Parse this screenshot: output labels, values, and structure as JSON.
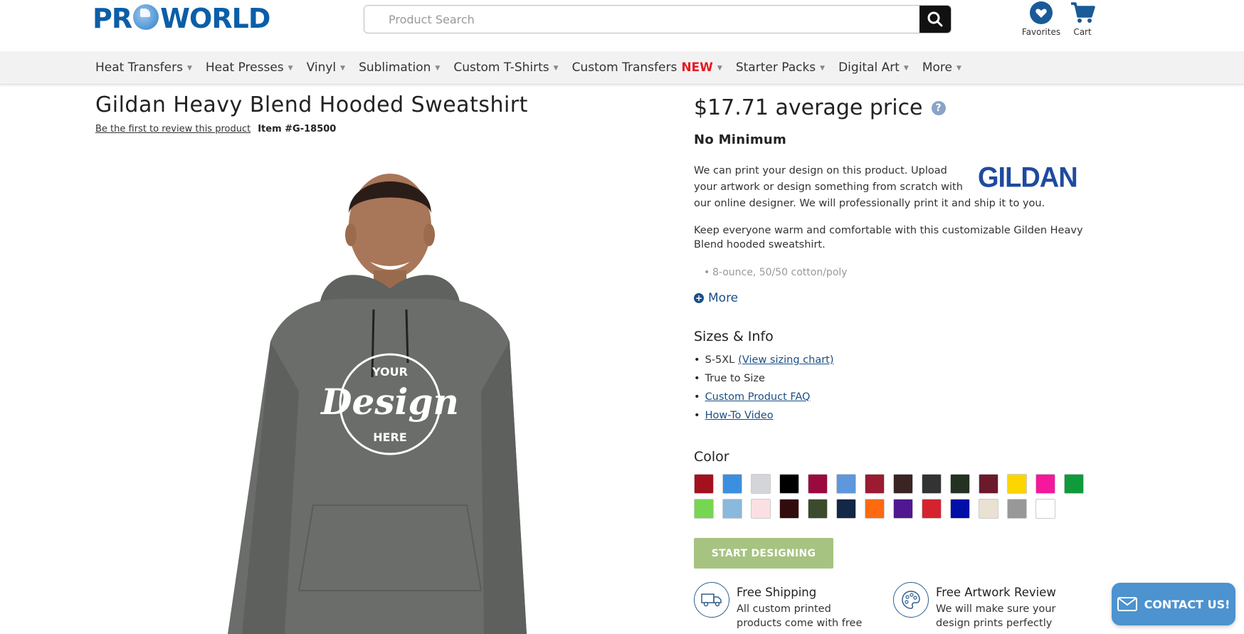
{
  "header": {
    "logo_left": "PR",
    "logo_right": "WORLD",
    "search_placeholder": "Product Search",
    "favorites_label": "Favorites",
    "cart_label": "Cart"
  },
  "nav": {
    "items": [
      {
        "label": "Heat Transfers"
      },
      {
        "label": "Heat Presses"
      },
      {
        "label": "Vinyl"
      },
      {
        "label": "Sublimation"
      },
      {
        "label": "Custom T-Shirts"
      },
      {
        "label": "Custom Transfers",
        "badge": "NEW"
      },
      {
        "label": "Starter Packs"
      },
      {
        "label": "Digital Art"
      },
      {
        "label": "More"
      }
    ]
  },
  "product": {
    "title": "Gildan Heavy Blend Hooded Sweatshirt",
    "review_link": "Be the first to review this product",
    "item_number": "Item #G-18500",
    "image_print_top": "YOUR",
    "image_print_main": "Design",
    "image_print_bottom": "HERE",
    "price": "$17.71 average price",
    "minimum": "No Minimum",
    "brand": "GILDAN",
    "desc_print_1": "We can print your design on this product. Upload your artwork or design something from scratch with",
    "desc_print_2": "our online designer. We will professionally print it and ship it to you.",
    "desc_main": "Keep everyone warm and comfortable with this customizable Gilden Heavy Blend hooded sweatshirt.",
    "feature_bullet": "8-ounce, 50/50 cotton/poly",
    "more_label": "More"
  },
  "sizes": {
    "title": "Sizes & Info",
    "size_range": "S-5XL",
    "sizing_chart_link": "(View sizing chart)",
    "fit": "True to Size",
    "faq_link": "Custom Product FAQ",
    "video_link": "How-To Video"
  },
  "color": {
    "title": "Color",
    "swatches": [
      "#a4111e",
      "#3b8fe0",
      "#d3d5d8",
      "#000000",
      "#9b0a3e",
      "#5f97dc",
      "#9b1b33",
      "#3a2424",
      "#333333",
      "#243222",
      "#6b1a2c",
      "#ffd500",
      "#f5179c",
      "#0f9a3b",
      "#77d651",
      "#8ab9de",
      "#fbe0e3",
      "#320c0c",
      "#3c4a2e",
      "#132746",
      "#ff6a10",
      "#4f1790",
      "#d4232e",
      "#000fa8",
      "#e9e1d2",
      "#989898",
      "#ffffff"
    ]
  },
  "cta": {
    "start_label": "START DESIGNING"
  },
  "features": {
    "shipping_title": "Free Shipping",
    "shipping_text": "All custom printed products come with free",
    "artwork_title": "Free Artwork Review",
    "artwork_text": "We will make sure your design prints perfectly"
  },
  "contact": {
    "label": "CONTACT US!"
  },
  "colors": {
    "brand_blue": "#0b5ea8",
    "start_button": "#a6c382",
    "contact_button": "#4c93cf",
    "new_badge": "#e41b23"
  }
}
